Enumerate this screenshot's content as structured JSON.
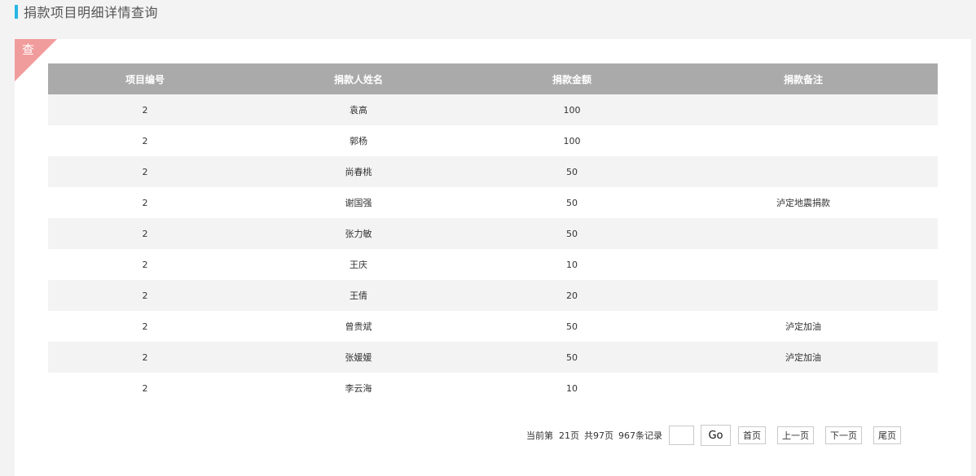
{
  "header": {
    "title": "捐款项目明细详情查询",
    "accent_color": "#27b6e4"
  },
  "panel": {
    "corner_label": "查",
    "corner_color": "#f19c9c"
  },
  "table": {
    "columns": [
      "项目编号",
      "捐款人姓名",
      "捐款金额",
      "捐款备注"
    ],
    "header_bg": "#aaaaaa",
    "rows": [
      {
        "project_id": "2",
        "donor": "袁高",
        "amount": "100",
        "note": ""
      },
      {
        "project_id": "2",
        "donor": "郭杨",
        "amount": "100",
        "note": ""
      },
      {
        "project_id": "2",
        "donor": "尚春桃",
        "amount": "50",
        "note": ""
      },
      {
        "project_id": "2",
        "donor": "谢国强",
        "amount": "50",
        "note": "泸定地震捐款"
      },
      {
        "project_id": "2",
        "donor": "张力敏",
        "amount": "50",
        "note": ""
      },
      {
        "project_id": "2",
        "donor": "王庆",
        "amount": "10",
        "note": ""
      },
      {
        "project_id": "2",
        "donor": "王倩",
        "amount": "20",
        "note": ""
      },
      {
        "project_id": "2",
        "donor": "曾贵斌",
        "amount": "50",
        "note": "泸定加油"
      },
      {
        "project_id": "2",
        "donor": "张媛媛",
        "amount": "50",
        "note": "泸定加油"
      },
      {
        "project_id": "2",
        "donor": "李云海",
        "amount": "10",
        "note": ""
      }
    ]
  },
  "pager": {
    "current_text": "当前第  21页",
    "total_pages_text": "共97页",
    "records_text": "967条记录",
    "page_input_value": "",
    "go_label": "Go",
    "first_label": "首页",
    "prev_label": "上一页",
    "next_label": "下一页",
    "last_label": "尾页"
  }
}
